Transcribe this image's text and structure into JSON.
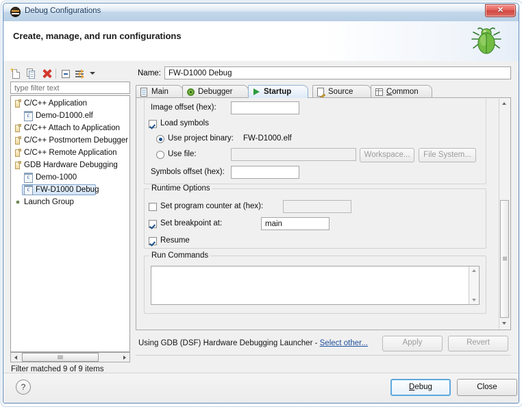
{
  "window": {
    "title": "Debug Configurations",
    "title_icon": "eclipse-icon",
    "close_glyph": "✕"
  },
  "banner": {
    "title": "Create, manage, and run configurations",
    "icon": "green-bug-icon"
  },
  "tree_toolbar": {
    "buttons": [
      {
        "name": "new-launch-configuration",
        "icon": "new-document-icon"
      },
      {
        "name": "duplicate-launch-configuration",
        "icon": "copy-document-icon"
      },
      {
        "name": "delete-launch-configuration",
        "icon": "red-delete-x-icon"
      },
      {
        "name": "collapse-all",
        "icon": "collapse-all-icon"
      },
      {
        "name": "filter-launch-configurations",
        "icon": "filter-icon"
      },
      {
        "name": "view-menu",
        "icon": "chevron-down-icon"
      }
    ]
  },
  "filter": {
    "placeholder": "type filter text",
    "value": ""
  },
  "tree": {
    "items": [
      {
        "label": "C/C++ Application",
        "type": "category",
        "indent": 0,
        "selected": false
      },
      {
        "label": "Demo-D1000.elf",
        "type": "config",
        "indent": 1,
        "selected": false
      },
      {
        "label": "C/C++ Attach to Application",
        "type": "category",
        "indent": 0,
        "selected": false
      },
      {
        "label": "C/C++ Postmortem Debugger",
        "type": "category",
        "indent": 0,
        "selected": false
      },
      {
        "label": "C/C++ Remote Application",
        "type": "category",
        "indent": 0,
        "selected": false
      },
      {
        "label": "GDB Hardware Debugging",
        "type": "category",
        "indent": 0,
        "selected": false
      },
      {
        "label": "Demo-1000",
        "type": "config",
        "indent": 1,
        "selected": false
      },
      {
        "label": "FW-D1000 Debug",
        "type": "config",
        "indent": 1,
        "selected": true
      },
      {
        "label": "Launch Group",
        "type": "group",
        "indent": 0,
        "selected": false
      }
    ],
    "status": "Filter matched 9 of 9 items"
  },
  "name_field": {
    "label": "Name:",
    "value": "FW-D1000 Debug",
    "placeholder": ""
  },
  "tabs": [
    {
      "label": "Main",
      "icon": "page-icon",
      "active": false,
      "mnemonic": ""
    },
    {
      "label": "Debugger",
      "icon": "debugger-gear-icon",
      "active": false,
      "mnemonic": ""
    },
    {
      "label": "Startup",
      "icon": "green-play-icon",
      "active": true,
      "mnemonic": ""
    },
    {
      "label": "Source",
      "icon": "source-pencil-icon",
      "active": false,
      "mnemonic": ""
    },
    {
      "label": "Common",
      "icon": "common-table-icon",
      "active": false,
      "mnemonic": "C"
    }
  ],
  "startup_tab": {
    "image_offset": {
      "label": "Image offset (hex):",
      "value": ""
    },
    "load_symbols": {
      "label": "Load symbols",
      "checked": true
    },
    "use_project_binary": {
      "label": "Use project binary:",
      "selected": true,
      "value": "FW-D1000.elf"
    },
    "use_file": {
      "label": "Use file:",
      "selected": false,
      "value": ""
    },
    "workspace_button": "Workspace...",
    "file_system_button": "File System...",
    "symbols_offset": {
      "label": "Symbols offset (hex):",
      "value": ""
    },
    "runtime_options": {
      "title": "Runtime Options",
      "set_program_counter": {
        "label": "Set program counter at (hex):",
        "checked": false,
        "value": ""
      },
      "set_breakpoint": {
        "label": "Set breakpoint at:",
        "checked": true,
        "value": "main"
      },
      "resume": {
        "label": "Resume",
        "checked": true
      }
    },
    "run_commands": {
      "title": "Run Commands",
      "value": ""
    }
  },
  "launcher": {
    "text": "Using GDB (DSF) Hardware Debugging Launcher - ",
    "link": "Select other...",
    "apply_button": "Apply",
    "revert_button": "Revert",
    "apply_enabled": false,
    "revert_enabled": false
  },
  "footer": {
    "help_glyph": "?",
    "debug_button": "Debug",
    "debug_mnemonic": "D",
    "close_button": "Close"
  },
  "colors": {
    "titlebar_blue": "#b8cfe5",
    "selection_blue": "#d2e4f6",
    "link_blue": "#1c4f9c",
    "delete_red": "#d33a2e",
    "bug_green": "#7dbb45",
    "focus_blue": "#5da8dd"
  }
}
